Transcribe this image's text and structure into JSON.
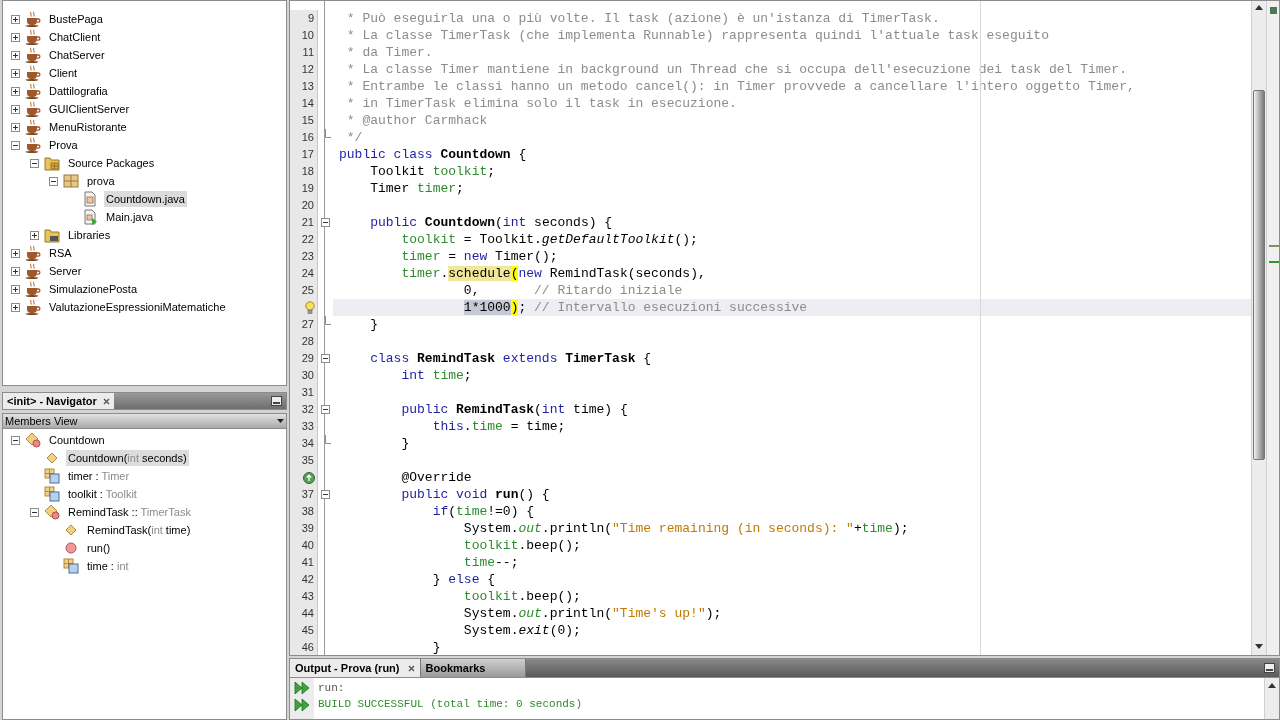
{
  "projects": {
    "items": [
      {
        "label": "BustePaga",
        "kind": "project",
        "expanded": false,
        "selected": false
      },
      {
        "label": "ChatClient",
        "kind": "project",
        "expanded": false,
        "selected": false
      },
      {
        "label": "ChatServer",
        "kind": "project",
        "expanded": false,
        "selected": false
      },
      {
        "label": "Client",
        "kind": "project",
        "expanded": false,
        "selected": false
      },
      {
        "label": "Dattilografia",
        "kind": "project",
        "expanded": false,
        "selected": false
      },
      {
        "label": "GUIClientServer",
        "kind": "project",
        "expanded": false,
        "selected": false
      },
      {
        "label": "MenuRistorante",
        "kind": "project",
        "expanded": false,
        "selected": false
      },
      {
        "label": "Prova",
        "kind": "project",
        "expanded": true,
        "selected": false,
        "children": [
          {
            "label": "Source Packages",
            "kind": "source-folder",
            "expanded": true,
            "selected": false,
            "children": [
              {
                "label": "prova",
                "kind": "package",
                "expanded": true,
                "selected": false,
                "children": [
                  {
                    "label": "Countdown.java",
                    "kind": "file",
                    "selected": true
                  },
                  {
                    "label": "Main.java",
                    "kind": "main-file",
                    "selected": false
                  }
                ]
              }
            ]
          },
          {
            "label": "Libraries",
            "kind": "libraries",
            "expanded": false,
            "selected": false
          }
        ]
      },
      {
        "label": "RSA",
        "kind": "project",
        "expanded": false,
        "selected": false
      },
      {
        "label": "Server",
        "kind": "project",
        "expanded": false,
        "selected": false
      },
      {
        "label": "SimulazionePosta",
        "kind": "project",
        "expanded": false,
        "selected": false
      },
      {
        "label": "ValutazioneEspressioniMatematiche",
        "kind": "project",
        "expanded": false,
        "selected": false
      }
    ]
  },
  "navigator": {
    "title": "<init> - Navigator",
    "view": "Members View",
    "items": [
      {
        "kind": "class",
        "parts": [
          {
            "text": "Countdown",
            "muted": false
          }
        ],
        "expanded": true,
        "selected": false,
        "children": [
          {
            "kind": "constructor",
            "parts": [
              {
                "text": "Countdown(",
                "muted": false
              },
              {
                "text": "int",
                "muted": true
              },
              {
                "text": " seconds)",
                "muted": false
              }
            ],
            "selected": true
          },
          {
            "kind": "field",
            "parts": [
              {
                "text": "timer : ",
                "muted": false
              },
              {
                "text": "Timer",
                "muted": true
              }
            ],
            "selected": false
          },
          {
            "kind": "field",
            "parts": [
              {
                "text": "toolkit : ",
                "muted": false
              },
              {
                "text": "Toolkit",
                "muted": true
              }
            ],
            "selected": false
          },
          {
            "kind": "class",
            "parts": [
              {
                "text": "RemindTask :: ",
                "muted": false
              },
              {
                "text": "TimerTask",
                "muted": true
              }
            ],
            "expanded": true,
            "selected": false,
            "children": [
              {
                "kind": "constructor",
                "parts": [
                  {
                    "text": "RemindTask(",
                    "muted": false
                  },
                  {
                    "text": "int",
                    "muted": true
                  },
                  {
                    "text": " time)",
                    "muted": false
                  }
                ],
                "selected": false
              },
              {
                "kind": "method",
                "parts": [
                  {
                    "text": "run()",
                    "muted": false
                  }
                ],
                "selected": false
              },
              {
                "kind": "field",
                "parts": [
                  {
                    "text": "time : ",
                    "muted": false
                  },
                  {
                    "text": "int",
                    "muted": true
                  }
                ],
                "selected": false
              }
            ]
          }
        ]
      }
    ]
  },
  "editor": {
    "lines": [
      {
        "number": "9",
        "kind": "plain",
        "current": false,
        "tokens": [
          {
            "kind": "comment",
            "text": " * Può eseguirla una o più volte. Il task (azione) è un'istanza di TimerTask."
          }
        ]
      },
      {
        "number": "10",
        "kind": "plain",
        "current": false,
        "tokens": [
          {
            "kind": "comment",
            "text": " * La classe TimerTask (che implementa Runnable) rappresenta quindi l'attuale task eseguito"
          }
        ]
      },
      {
        "number": "11",
        "kind": "plain",
        "current": false,
        "tokens": [
          {
            "kind": "comment",
            "text": " * da Timer."
          }
        ]
      },
      {
        "number": "12",
        "kind": "plain",
        "current": false,
        "tokens": [
          {
            "kind": "comment",
            "text": " * La classe Timer mantiene in background un Thread che si occupa dell'esecuzione dei task del Timer."
          }
        ]
      },
      {
        "number": "13",
        "kind": "plain",
        "current": false,
        "tokens": [
          {
            "kind": "comment",
            "text": " * Entrambe le classi hanno un metodo cancel(): in Timer provvede a cancellare l'intero oggetto Timer,"
          }
        ]
      },
      {
        "number": "14",
        "kind": "plain",
        "current": false,
        "tokens": [
          {
            "kind": "comment",
            "text": " * in TimerTask elimina solo il task in esecuzione."
          }
        ]
      },
      {
        "number": "15",
        "kind": "plain",
        "current": false,
        "tokens": [
          {
            "kind": "comment",
            "text": " * @author Carmhack"
          }
        ]
      },
      {
        "number": "16",
        "kind": "fold-end",
        "current": false,
        "tokens": [
          {
            "kind": "comment",
            "text": " */"
          }
        ]
      },
      {
        "number": "17",
        "kind": "plain",
        "current": false,
        "tokens": [
          {
            "kind": "keyword",
            "text": "public class "
          },
          {
            "kind": "declaration",
            "text": "Countdown"
          },
          {
            "kind": "plain",
            "text": " {"
          }
        ]
      },
      {
        "number": "18",
        "kind": "plain",
        "current": false,
        "tokens": [
          {
            "kind": "plain",
            "text": "    Toolkit "
          },
          {
            "kind": "field",
            "text": "toolkit"
          },
          {
            "kind": "plain",
            "text": ";"
          }
        ]
      },
      {
        "number": "19",
        "kind": "plain",
        "current": false,
        "tokens": [
          {
            "kind": "plain",
            "text": "    Timer "
          },
          {
            "kind": "field",
            "text": "timer"
          },
          {
            "kind": "plain",
            "text": ";"
          }
        ]
      },
      {
        "number": "20",
        "kind": "plain",
        "current": false
      },
      {
        "number": "21",
        "kind": "fold-start",
        "current": false,
        "tokens": [
          {
            "kind": "keyword",
            "text": "    public "
          },
          {
            "kind": "declaration",
            "text": "Countdown"
          },
          {
            "kind": "plain",
            "text": "("
          },
          {
            "kind": "keyword",
            "text": "int"
          },
          {
            "kind": "plain",
            "text": " seconds) {"
          }
        ]
      },
      {
        "number": "22",
        "kind": "plain",
        "current": false,
        "tokens": [
          {
            "kind": "field",
            "text": "        toolkit"
          },
          {
            "kind": "plain",
            "text": " = Toolkit."
          },
          {
            "kind": "static",
            "text": "getDefaultToolkit"
          },
          {
            "kind": "plain",
            "text": "();"
          }
        ]
      },
      {
        "number": "23",
        "kind": "plain",
        "current": false,
        "tokens": [
          {
            "kind": "field",
            "text": "        timer"
          },
          {
            "kind": "plain",
            "text": " = "
          },
          {
            "kind": "keyword",
            "text": "new"
          },
          {
            "kind": "plain",
            "text": " Timer();"
          }
        ]
      },
      {
        "number": "24",
        "kind": "plain",
        "current": false,
        "tokens": [
          {
            "kind": "field",
            "text": "        timer"
          },
          {
            "kind": "plain",
            "text": "."
          },
          {
            "kind": "occurrence",
            "text": "schedule"
          },
          {
            "kind": "brace",
            "text": "("
          },
          {
            "kind": "keyword",
            "text": "new"
          },
          {
            "kind": "plain",
            "text": " RemindTask(seconds),"
          }
        ]
      },
      {
        "number": "25",
        "kind": "plain",
        "current": false,
        "tokens": [
          {
            "kind": "plain",
            "text": "                0,       "
          },
          {
            "kind": "comment",
            "text": "// Ritardo iniziale"
          }
        ]
      },
      {
        "kind": "hint",
        "current": true,
        "tokens": [
          {
            "kind": "selection",
            "text": "                1*1000"
          },
          {
            "kind": "brace",
            "text": ")"
          },
          {
            "kind": "plain",
            "text": "; "
          },
          {
            "kind": "comment",
            "text": "// Intervallo esecuzioni successive"
          }
        ]
      },
      {
        "number": "27",
        "kind": "fold-end",
        "current": false,
        "tokens": [
          {
            "kind": "plain",
            "text": "    }"
          }
        ]
      },
      {
        "number": "28",
        "kind": "plain",
        "current": false
      },
      {
        "number": "29",
        "kind": "fold-start",
        "current": false,
        "tokens": [
          {
            "kind": "keyword",
            "text": "    class "
          },
          {
            "kind": "declaration",
            "text": "RemindTask"
          },
          {
            "kind": "keyword",
            "text": " extends "
          },
          {
            "kind": "declaration",
            "text": "TimerTask"
          },
          {
            "kind": "plain",
            "text": " {"
          }
        ]
      },
      {
        "number": "30",
        "kind": "plain",
        "current": false,
        "tokens": [
          {
            "kind": "keyword",
            "text": "        int "
          },
          {
            "kind": "field",
            "text": "time"
          },
          {
            "kind": "plain",
            "text": ";"
          }
        ]
      },
      {
        "number": "31",
        "kind": "plain",
        "current": false
      },
      {
        "number": "32",
        "kind": "fold-start",
        "current": false,
        "tokens": [
          {
            "kind": "keyword",
            "text": "        public "
          },
          {
            "kind": "declaration",
            "text": "RemindTask"
          },
          {
            "kind": "plain",
            "text": "("
          },
          {
            "kind": "keyword",
            "text": "int"
          },
          {
            "kind": "plain",
            "text": " time) {"
          }
        ]
      },
      {
        "number": "33",
        "kind": "plain",
        "current": false,
        "tokens": [
          {
            "kind": "keyword",
            "text": "            this"
          },
          {
            "kind": "plain",
            "text": "."
          },
          {
            "kind": "field",
            "text": "time"
          },
          {
            "kind": "plain",
            "text": " = time;"
          }
        ]
      },
      {
        "number": "34",
        "kind": "fold-end",
        "current": false,
        "tokens": [
          {
            "kind": "plain",
            "text": "        }"
          }
        ]
      },
      {
        "number": "35",
        "kind": "plain",
        "current": false
      },
      {
        "kind": "override",
        "current": false,
        "tokens": [
          {
            "kind": "plain",
            "text": "        @Override"
          }
        ]
      },
      {
        "number": "37",
        "kind": "fold-start",
        "current": false,
        "tokens": [
          {
            "kind": "keyword",
            "text": "        public void "
          },
          {
            "kind": "declaration",
            "text": "run"
          },
          {
            "kind": "plain",
            "text": "() {"
          }
        ]
      },
      {
        "number": "38",
        "kind": "plain",
        "current": false,
        "tokens": [
          {
            "kind": "keyword",
            "text": "            if"
          },
          {
            "kind": "plain",
            "text": "("
          },
          {
            "kind": "field",
            "text": "time"
          },
          {
            "kind": "plain",
            "text": "!=0) {"
          }
        ]
      },
      {
        "number": "39",
        "kind": "plain",
        "current": false,
        "tokens": [
          {
            "kind": "plain",
            "text": "                System."
          },
          {
            "kind": "static-field",
            "text": "out"
          },
          {
            "kind": "plain",
            "text": ".println("
          },
          {
            "kind": "string",
            "text": "\"Time remaining (in seconds): \""
          },
          {
            "kind": "plain",
            "text": "+"
          },
          {
            "kind": "field",
            "text": "time"
          },
          {
            "kind": "plain",
            "text": ");"
          }
        ]
      },
      {
        "number": "40",
        "kind": "plain",
        "current": false,
        "tokens": [
          {
            "kind": "field",
            "text": "                toolkit"
          },
          {
            "kind": "plain",
            "text": ".beep();"
          }
        ]
      },
      {
        "number": "41",
        "kind": "plain",
        "current": false,
        "tokens": [
          {
            "kind": "field",
            "text": "                time"
          },
          {
            "kind": "plain",
            "text": "--;"
          }
        ]
      },
      {
        "number": "42",
        "kind": "plain",
        "current": false,
        "tokens": [
          {
            "kind": "plain",
            "text": "            } "
          },
          {
            "kind": "keyword",
            "text": "else"
          },
          {
            "kind": "plain",
            "text": " {"
          }
        ]
      },
      {
        "number": "43",
        "kind": "plain",
        "current": false,
        "tokens": [
          {
            "kind": "field",
            "text": "                toolkit"
          },
          {
            "kind": "plain",
            "text": ".beep();"
          }
        ]
      },
      {
        "number": "44",
        "kind": "plain",
        "current": false,
        "tokens": [
          {
            "kind": "plain",
            "text": "                System."
          },
          {
            "kind": "static-field",
            "text": "out"
          },
          {
            "kind": "plain",
            "text": ".println("
          },
          {
            "kind": "string",
            "text": "\"Time's up!\""
          },
          {
            "kind": "plain",
            "text": ");"
          }
        ]
      },
      {
        "number": "45",
        "kind": "plain",
        "current": false,
        "tokens": [
          {
            "kind": "plain",
            "text": "                System."
          },
          {
            "kind": "static",
            "text": "exit"
          },
          {
            "kind": "plain",
            "text": "(0);"
          }
        ]
      },
      {
        "number": "46",
        "kind": "plain",
        "current": false,
        "tokens": [
          {
            "kind": "plain",
            "text": "            }"
          }
        ]
      }
    ]
  },
  "output": {
    "tabs": [
      {
        "label": "Output - Prova (run)",
        "selected": true,
        "closable": true
      },
      {
        "label": "Bookmarks",
        "selected": false,
        "closable": false
      }
    ],
    "lines": [
      {
        "text": "run:",
        "kind": "plain"
      },
      {
        "text": "BUILD SUCCESSFUL (total time: 0 seconds)",
        "kind": "success"
      }
    ]
  }
}
